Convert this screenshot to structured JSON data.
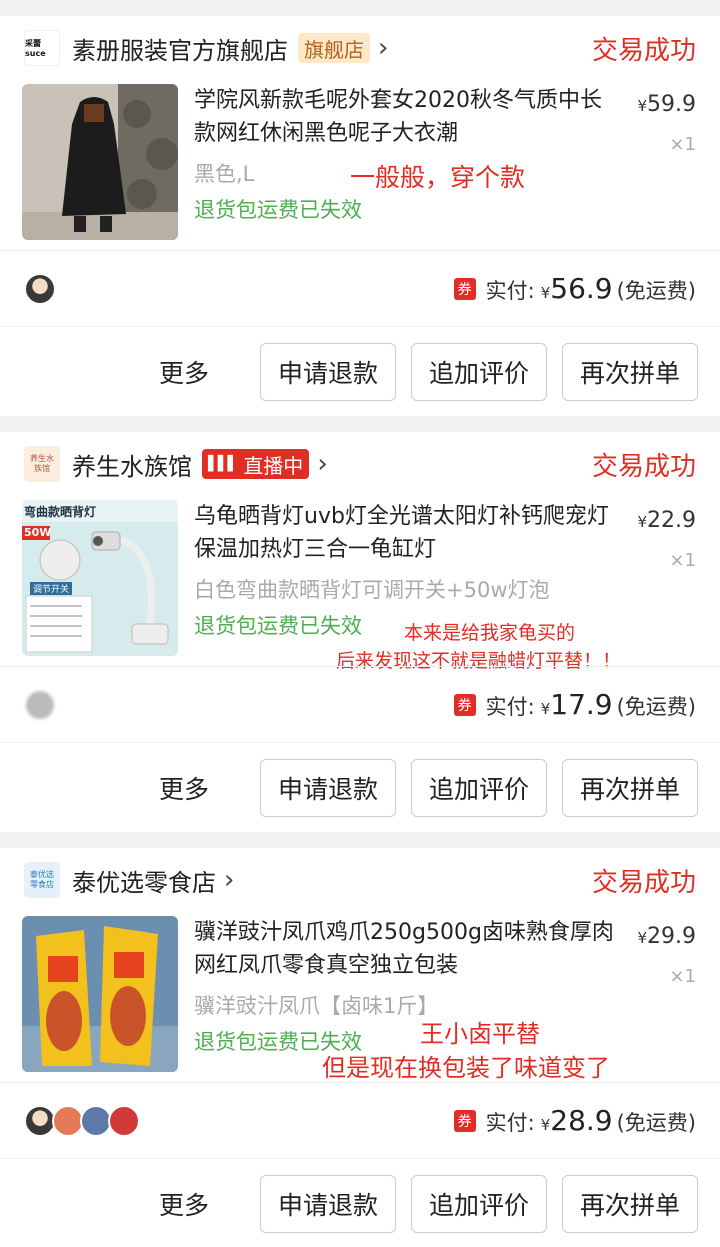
{
  "orders": [
    {
      "shop": {
        "logo_text": "采蕾suce",
        "name": "素册服装官方旗舰店",
        "badge": "旗舰店",
        "badge_type": "flagship"
      },
      "status": "交易成功",
      "product": {
        "title": "学院风新款毛呢外套女2020秋冬气质中长款网红休闲黑色呢子大衣潮",
        "sku": "黑色,L",
        "policy": "退货包运费已失效",
        "price_symbol": "¥",
        "price": "59.9",
        "qty": "×1"
      },
      "note_lines": [
        "一般般，穿个款"
      ],
      "payment": {
        "coupon": "券",
        "label": "实付:",
        "symbol": "¥",
        "amount": "56.9",
        "shipping": "(免运费)"
      },
      "actions": {
        "more": "更多",
        "refund": "申请退款",
        "review": "追加评价",
        "reorder": "再次拼单"
      }
    },
    {
      "shop": {
        "logo_text": "养生水族馆",
        "name": "养生水族馆",
        "badge": "直播中",
        "badge_type": "live"
      },
      "status": "交易成功",
      "product": {
        "title": "乌龟晒背灯uvb灯全光谱太阳灯补钙爬宠灯保温加热灯三合一龟缸灯",
        "thumb_caption": "弯曲款晒背灯",
        "thumb_watt": "50W",
        "thumb_switch": "调节开关",
        "sku": "白色弯曲款晒背灯可调开关+50w灯泡",
        "policy": "退货包运费已失效",
        "price_symbol": "¥",
        "price": "22.9",
        "qty": "×1"
      },
      "note_lines": [
        "本来是给我家龟买的",
        "后来发现这不就是融蜡灯平替！！"
      ],
      "payment": {
        "coupon": "券",
        "label": "实付:",
        "symbol": "¥",
        "amount": "17.9",
        "shipping": "(免运费)"
      },
      "actions": {
        "more": "更多",
        "refund": "申请退款",
        "review": "追加评价",
        "reorder": "再次拼单"
      }
    },
    {
      "shop": {
        "logo_text": "泰优选零食店",
        "name": "泰优选零食店",
        "badge": "",
        "badge_type": "none"
      },
      "status": "交易成功",
      "product": {
        "title": "骥洋豉汁凤爪鸡爪250g500g卤味熟食厚肉网红凤爪零食真空独立包装",
        "sku": "骥洋豉汁凤爪【卤味1斤】",
        "policy": "退货包运费已失效",
        "price_symbol": "¥",
        "price": "29.9",
        "qty": "×1"
      },
      "note_lines": [
        "王小卤平替",
        "但是现在换包装了味道变了"
      ],
      "payment": {
        "coupon": "券",
        "label": "实付:",
        "symbol": "¥",
        "amount": "28.9",
        "shipping": "(免运费)"
      },
      "actions": {
        "more": "更多",
        "refund": "申请退款",
        "review": "追加评价",
        "reorder": "再次拼单"
      }
    }
  ],
  "colors": {
    "accent": "#e02e24",
    "policy_green": "#4caf50",
    "flag_badge_bg": "#fde9c8"
  }
}
